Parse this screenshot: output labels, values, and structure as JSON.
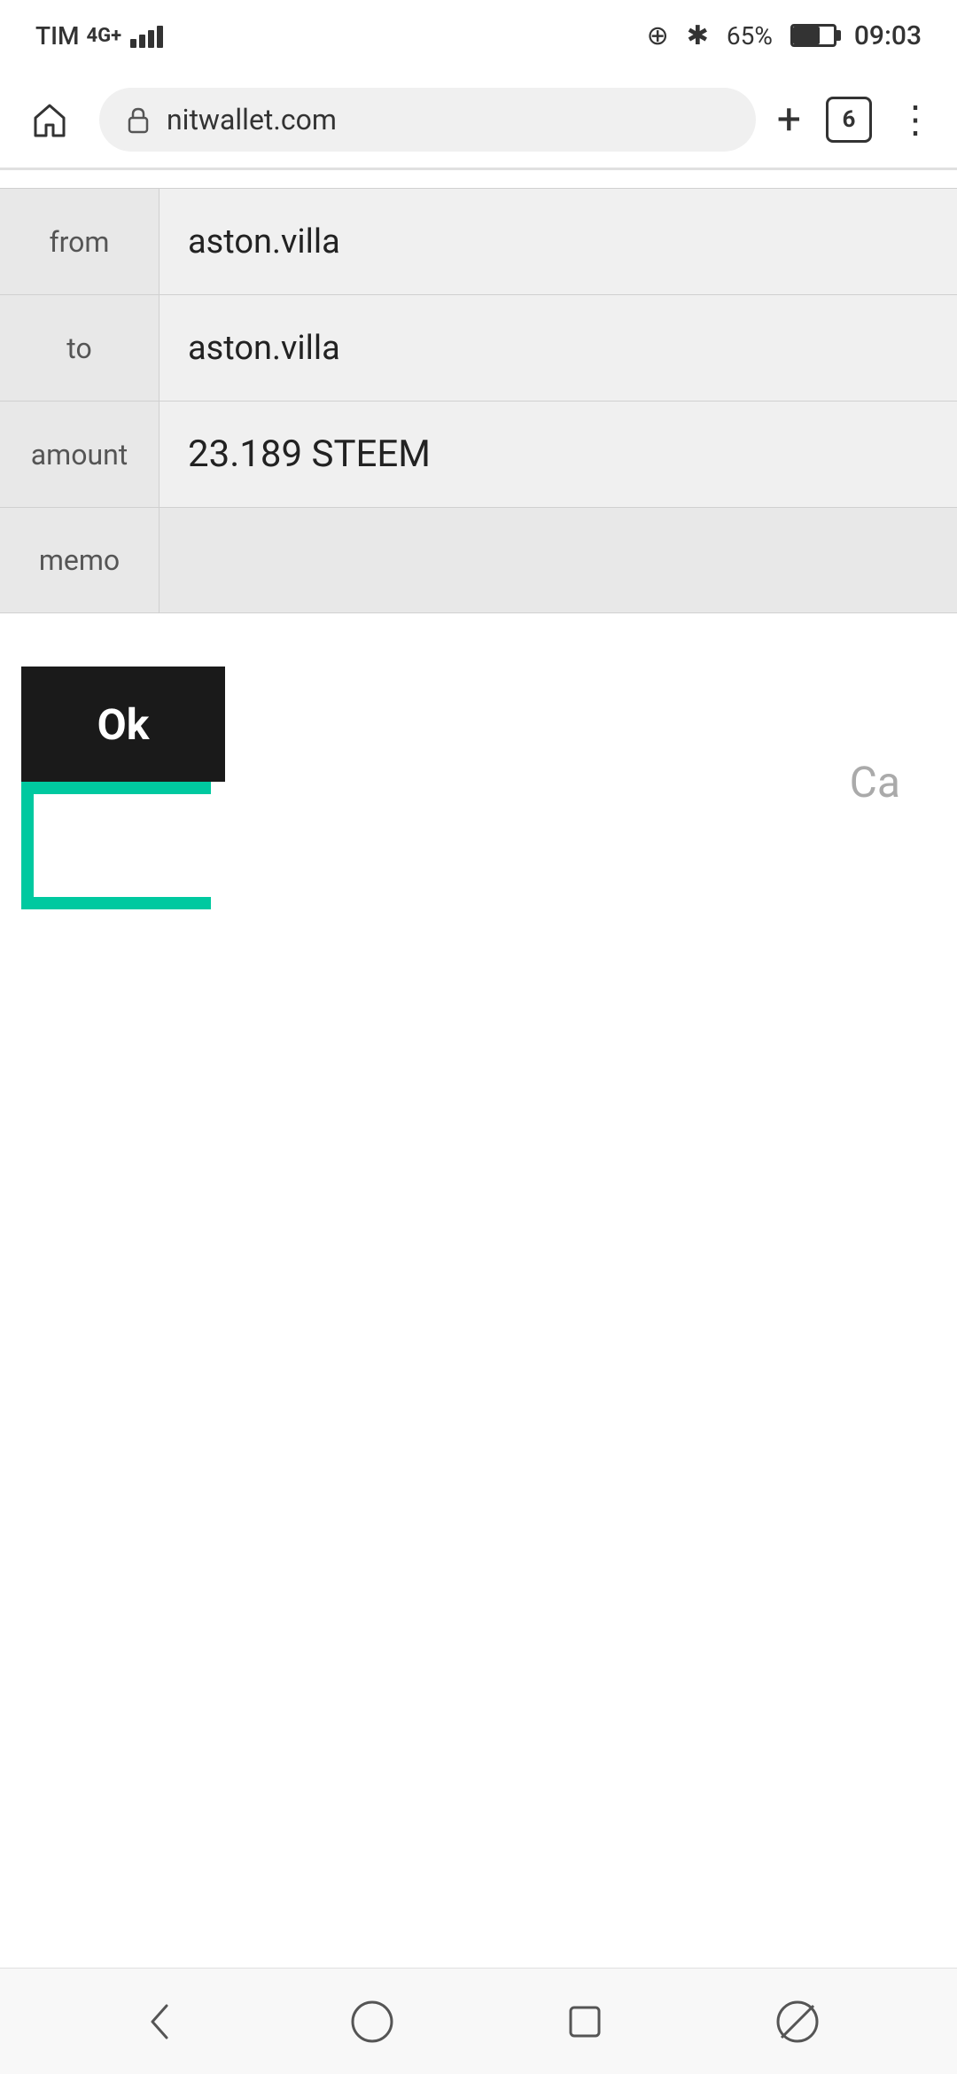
{
  "statusBar": {
    "carrier": "TIM",
    "network": "4G+",
    "bluetooth": "⊕",
    "battery": "65%",
    "time": "09:03"
  },
  "browser": {
    "url": "nitwallet.com",
    "tabs_count": "6",
    "home_label": "home",
    "plus_label": "+",
    "more_label": "⋮"
  },
  "form": {
    "from_label": "from",
    "from_value": "aston.villa",
    "to_label": "to",
    "to_value": "aston.villa",
    "amount_label": "amount",
    "amount_value": "23.189 STEEM",
    "memo_label": "memo",
    "memo_value": ""
  },
  "buttons": {
    "ok_label": "Ok",
    "cancel_label": "Ca"
  }
}
